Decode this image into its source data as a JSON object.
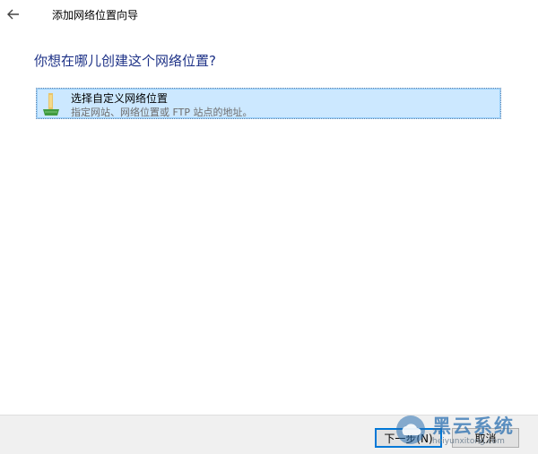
{
  "window": {
    "title": "添加网络位置向导",
    "back_icon": "back-arrow-icon"
  },
  "main": {
    "heading": "你想在哪儿创建这个网络位置?",
    "options": [
      {
        "icon": "folder-network-icon",
        "title": "选择自定义网络位置",
        "description": "指定网站、网络位置或 FTP 站点的地址。",
        "selected": true
      }
    ]
  },
  "footer": {
    "next_label": "下一步(N)",
    "cancel_label": "取消"
  },
  "watermark": {
    "name": "黑云系统",
    "site": "heiyunxitong.com"
  },
  "colors": {
    "heading": "#1e3287",
    "selection_bg": "#cce8ff",
    "primary_button_border": "#0078d7",
    "footer_bg": "#f0f0f0"
  }
}
